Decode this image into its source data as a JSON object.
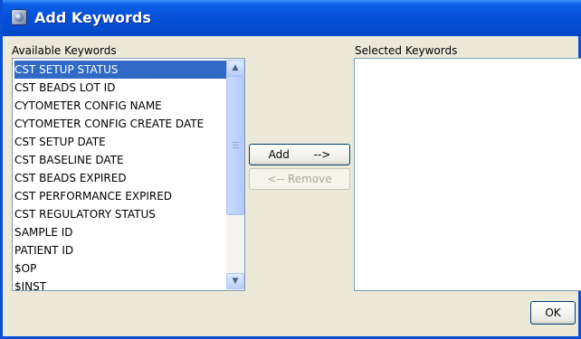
{
  "window": {
    "title": "Add Keywords",
    "icon": "app-globe-icon",
    "accent_color": "#0550d8"
  },
  "available": {
    "label": "Available Keywords",
    "items": [
      "CST SETUP STATUS",
      "CST BEADS LOT ID",
      "CYTOMETER CONFIG NAME",
      "CYTOMETER CONFIG CREATE DATE",
      "CST SETUP DATE",
      "CST BASELINE DATE",
      "CST BEADS EXPIRED",
      "CST PERFORMANCE EXPIRED",
      "CST REGULATORY STATUS",
      "SAMPLE ID",
      "PATIENT ID",
      "$OP",
      "$INST"
    ],
    "selected_item": "CST SETUP STATUS",
    "selection_color": "#316ac5"
  },
  "buttons": {
    "add_label": "Add       -->",
    "remove_label": "<-- Remove",
    "ok_label": "OK"
  },
  "selected": {
    "label": "Selected Keywords",
    "items": []
  }
}
